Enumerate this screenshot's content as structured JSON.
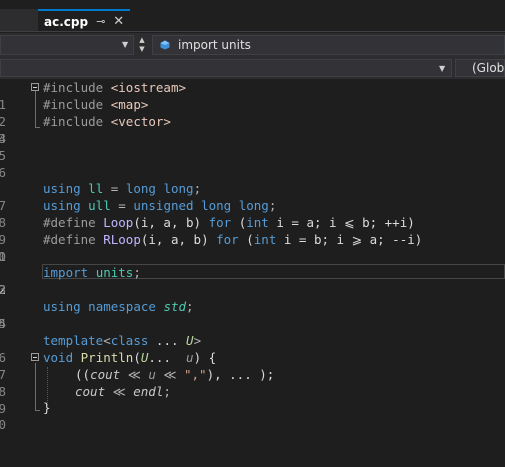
{
  "tabs": [
    {
      "label": "ac.cpp",
      "active": true,
      "pin_glyph": "⊸",
      "close_glyph": "✕"
    }
  ],
  "navigation": {
    "member_dropdown": {
      "icon": "cube-icon",
      "value": "import units"
    },
    "global_dropdown": {
      "value": "(Global Scope)"
    }
  },
  "editor": {
    "current_line_number": "2",
    "line_numbers": [
      "1",
      "2",
      "3",
      "4",
      "5",
      "6",
      "7",
      "8",
      "9",
      "0",
      "1",
      "2",
      "3",
      "4",
      "5",
      "6",
      "7",
      "8",
      "9",
      "0"
    ],
    "code": {
      "l1": {
        "pp": "#include",
        "hdr": "<iostream>"
      },
      "l2": {
        "pp": "#include",
        "hdr": "<map>"
      },
      "l3": {
        "pp": "#include",
        "hdr": "<vector>"
      },
      "l7": {
        "kw": "using",
        "name": "ll",
        "eq": "=",
        "type": "long long",
        "semi": ";"
      },
      "l8": {
        "kw": "using",
        "name": "ull",
        "eq": "=",
        "type": "unsigned long long",
        "semi": ";"
      },
      "l9": {
        "pp": "#define",
        "macro": "Loop",
        "params": "(i, a, b)",
        "kw_for": "for",
        "open": "(",
        "kw_int": "int",
        "body": " i = a; i ⩽ b; ++i)"
      },
      "l10": {
        "pp": "#define",
        "macro": "RLoop",
        "params": "(i, a, b)",
        "kw_for": "for",
        "open": "(",
        "kw_int": "int",
        "body": " i = b; i ⩾ a; --i)"
      },
      "l12": {
        "kw": "import",
        "name": "units",
        "semi": ";"
      },
      "l14": {
        "kw1": "using",
        "kw2": "namespace",
        "ns": "std",
        "semi": ";"
      },
      "l16": {
        "kw": "template",
        "lt": "<",
        "kw2": "class",
        "dots": "...",
        "tparam": "U",
        "gt": ">"
      },
      "l17": {
        "kw": "void",
        "fn": "Println",
        "open": "(",
        "tparam": "U",
        "dots": "...",
        "param": "u",
        "close": ") {"
      },
      "l18": {
        "p1": "((",
        "cout": "cout",
        "op": " ≪ ",
        "u": "u",
        "op2": " ≪ ",
        "str": "\",\"",
        "rest": "), ... );"
      },
      "l19": {
        "cout": "cout",
        "op": " ≪ ",
        "endl": "endl",
        "semi": ";"
      },
      "l20": {
        "brace": "}"
      }
    }
  }
}
